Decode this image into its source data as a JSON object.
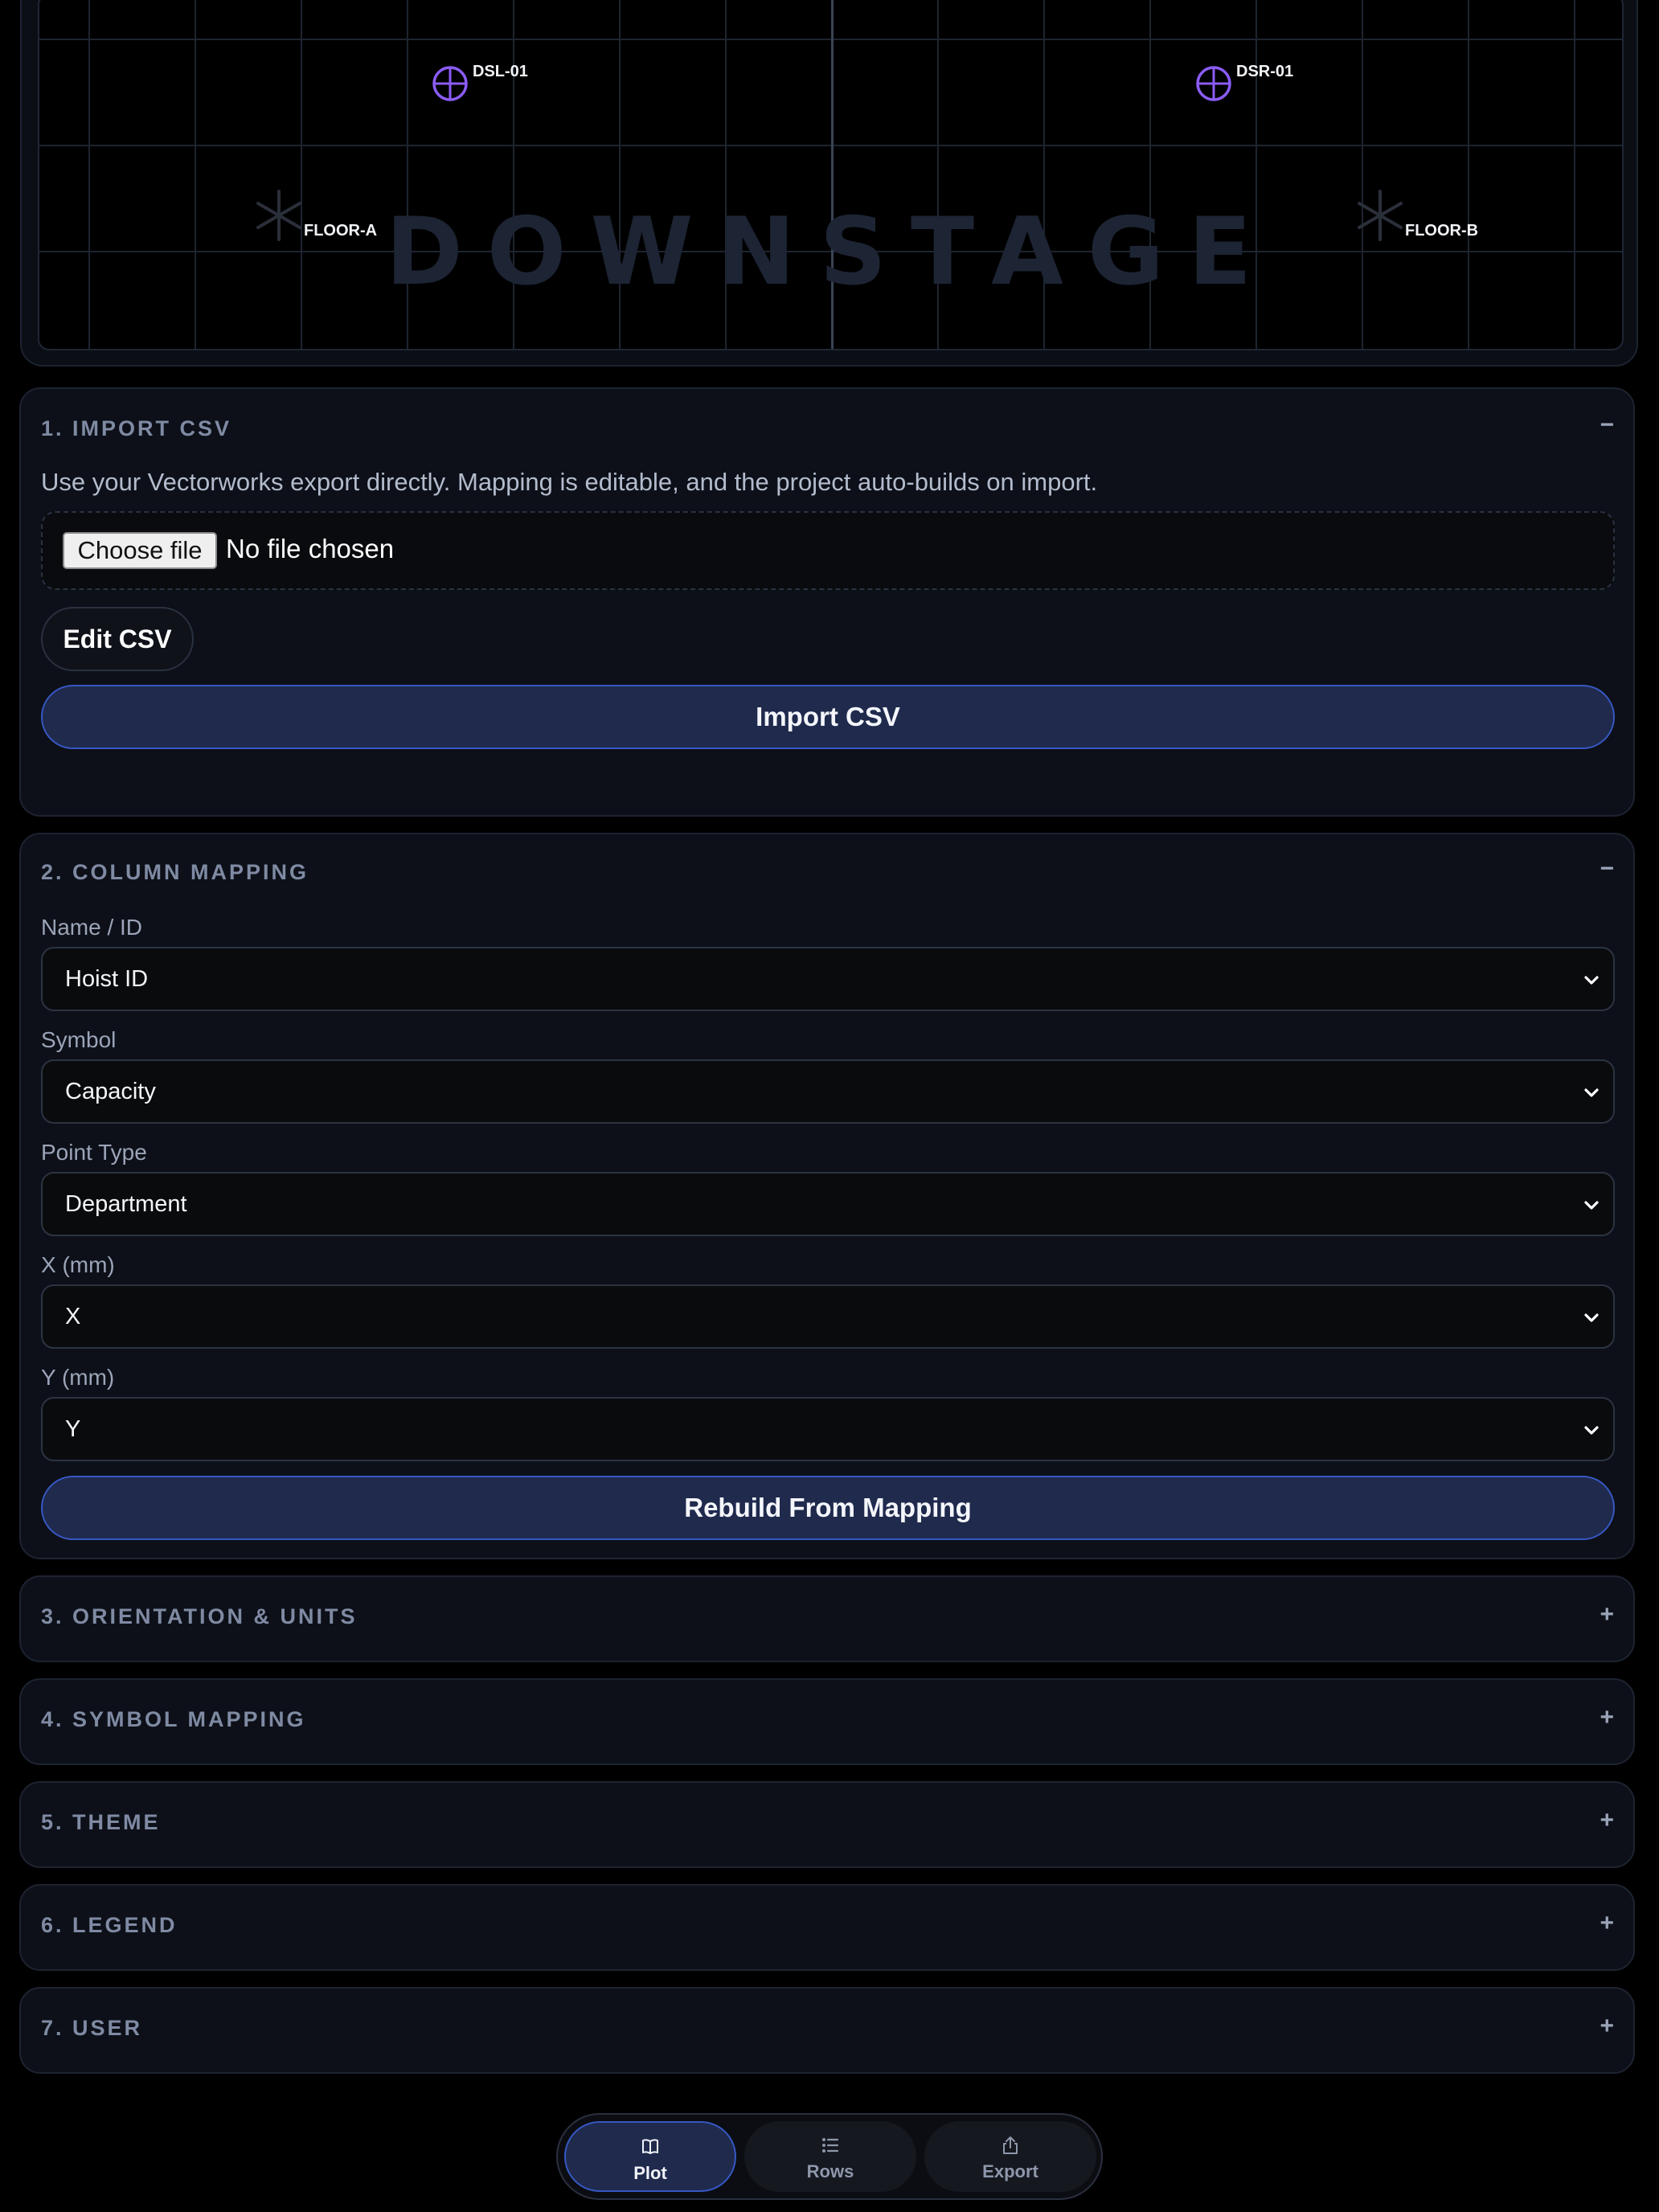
{
  "plot": {
    "stage_label": "DOWNSTAGE",
    "markers": [
      {
        "label": "DSL-01",
        "type": "hoist",
        "color": "#8b5cf6"
      },
      {
        "label": "DSR-01",
        "type": "hoist",
        "color": "#8b5cf6"
      },
      {
        "label": "FLOOR-A",
        "type": "floor-point",
        "color": "#2a2f3a"
      },
      {
        "label": "FLOOR-B",
        "type": "floor-point",
        "color": "#2a2f3a"
      }
    ]
  },
  "import_panel": {
    "title": "1. IMPORT CSV",
    "toggle": "−",
    "hint": "Use your Vectorworks export directly. Mapping is editable, and the project auto-builds on import.",
    "file_button": "Choose file",
    "file_status": "No file chosen",
    "edit_button": "Edit CSV",
    "import_button": "Import CSV"
  },
  "mapping_panel": {
    "title": "2. COLUMN MAPPING",
    "toggle": "−",
    "fields": [
      {
        "label": "Name / ID",
        "value": "Hoist ID"
      },
      {
        "label": "Symbol",
        "value": "Capacity"
      },
      {
        "label": "Point Type",
        "value": "Department"
      },
      {
        "label": "X (mm)",
        "value": "X"
      },
      {
        "label": "Y (mm)",
        "value": "Y"
      }
    ],
    "rebuild_button": "Rebuild From Mapping"
  },
  "collapsed_panels": [
    {
      "title": "3. ORIENTATION & UNITS",
      "toggle": "+"
    },
    {
      "title": "4. SYMBOL MAPPING",
      "toggle": "+"
    },
    {
      "title": "5. THEME",
      "toggle": "+"
    },
    {
      "title": "6. LEGEND",
      "toggle": "+"
    },
    {
      "title": "7. USER",
      "toggle": "+"
    }
  ],
  "bottom_nav": {
    "tabs": [
      {
        "label": "Plot",
        "icon": "book-icon",
        "active": true
      },
      {
        "label": "Rows",
        "icon": "list-icon",
        "active": false
      },
      {
        "label": "Export",
        "icon": "share-icon",
        "active": false
      }
    ]
  },
  "colors": {
    "accent": "#3758c4",
    "accent_fill": "#1f2a4d",
    "hoist_marker": "#8b5cf6",
    "panel_bg": "#0d1018"
  }
}
